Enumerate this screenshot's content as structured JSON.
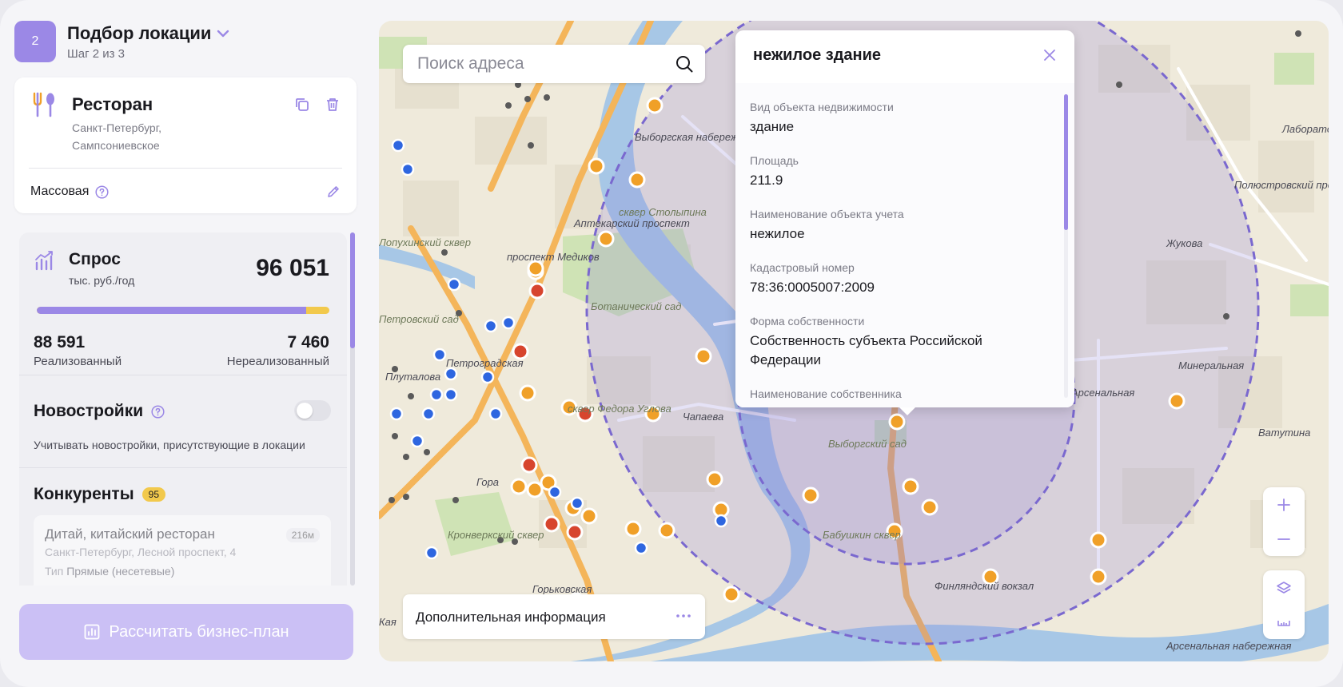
{
  "step": {
    "number": "2",
    "title": "Подбор локации",
    "subtitle": "Шаг 2 из 3"
  },
  "restaurant": {
    "title": "Ресторан",
    "address": "Санкт-Петербург, Сампсониевское",
    "mode": "Массовая"
  },
  "demand": {
    "title": "Спрос",
    "unit": "тыс. руб./год",
    "total": "96 051",
    "realized_value": "88 591",
    "realized_label": "Реализованный",
    "unrealized_value": "7 460",
    "unrealized_label": "Нереализованный",
    "realized_share": 0.922
  },
  "new_buildings": {
    "title": "Новостройки",
    "description": "Учитывать новостройки, присутствующие в локации",
    "enabled": false
  },
  "competitors": {
    "title": "Конкуренты",
    "count": "95",
    "items": [
      {
        "name": "Дитай, китайский ресторан",
        "distance": "216м",
        "address": "Санкт-Петербург, Лесной проспект, 4",
        "type_label": "Тип",
        "type_value": "Прямые (несетевые)"
      }
    ]
  },
  "calc_button": {
    "label": "Рассчитать бизнес-план"
  },
  "map": {
    "search_placeholder": "Поиск адреса",
    "extra_label": "Дополнительная информация",
    "labels": [
      "сквер Столыпина",
      "Ботанический сад",
      "сквер Федора Углова",
      "Выборгский сад",
      "Бабушкин сквер",
      "Финляндский вокзал",
      "Минеральная",
      "Жукова",
      "Полюстровский проспект",
      "Лабораторная",
      "Арсенальная",
      "Арсенальная набережная",
      "Аптекарский проспект",
      "проспект Медиков",
      "Петроградская",
      "Горьковская",
      "Кронверкский сквер",
      "Выборгская набережная",
      "Чапаева",
      "Лопухинский сквер",
      "Петровский сад",
      "Плуталова",
      "Ватутина",
      "Кая",
      "Гора"
    ]
  },
  "popup": {
    "title": "нежилое здание",
    "fields": [
      {
        "label": "Вид объекта недвижимости",
        "value": "здание"
      },
      {
        "label": "Площадь",
        "value": "211.9"
      },
      {
        "label": "Наименование объекта учета",
        "value": "нежилое"
      },
      {
        "label": "Кадастровый номер",
        "value": "78:36:0005007:2009"
      },
      {
        "label": "Форма собственности",
        "value": "Собственность субъекта Российской Федерации"
      },
      {
        "label": "Наименование собственника",
        "value": ""
      }
    ]
  },
  "colors": {
    "accent": "#9b88e6",
    "accent_light": "#cbc0f5",
    "demand_unrealized": "#f2c94c",
    "marker_orange": "#f0a028",
    "marker_red": "#d7452e",
    "marker_blue": "#2e66e0"
  }
}
